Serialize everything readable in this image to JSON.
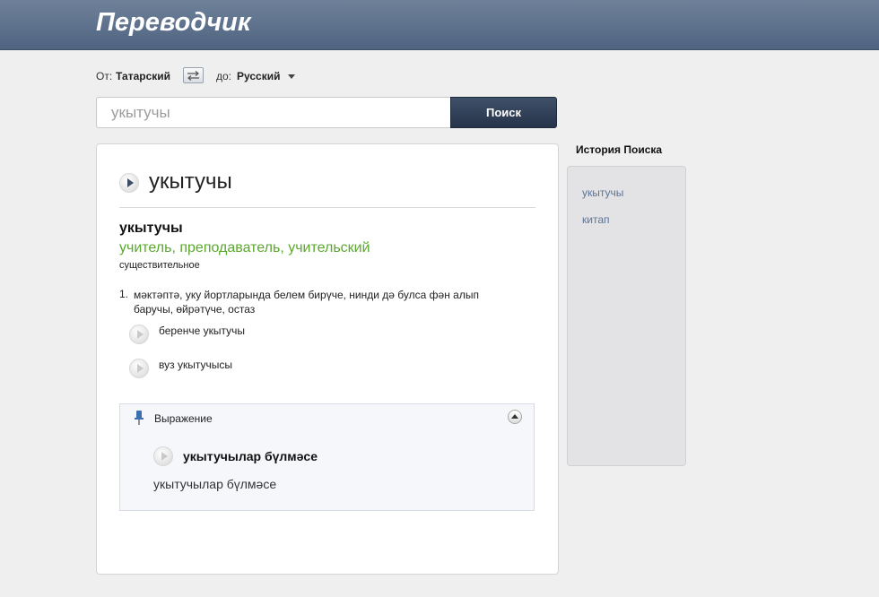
{
  "app": {
    "title": "Переводчик"
  },
  "langbar": {
    "from_label": "От:",
    "from_lang": "Татарский",
    "to_label": "до:",
    "to_lang": "Русский"
  },
  "search": {
    "value": "укытучы",
    "button": "Поиск"
  },
  "result": {
    "headword": "укытучы",
    "entry": {
      "word": "укытучы",
      "translation": "учитель, преподаватель, учительский",
      "pos": "существительное"
    },
    "definition": {
      "number": "1.",
      "text": "мәктәптә, уку йортларында белем бирүче, нинди дә булса фән алып баручы, өйрәтүче, остаз"
    },
    "examples": [
      "беренче укытучы",
      "вуз укытучысы"
    ],
    "expression": {
      "label": "Выражение",
      "phrase": "укытучылар бүлмәсе",
      "translation": "укытучылар бүлмәсе"
    }
  },
  "history": {
    "title": "История Поиска",
    "items": [
      "укытучы",
      "китап"
    ]
  },
  "colors": {
    "header": "#5b6f8c",
    "translation": "#5aa82e",
    "history_link": "#5b7497",
    "search_button": "#2d3b52"
  }
}
